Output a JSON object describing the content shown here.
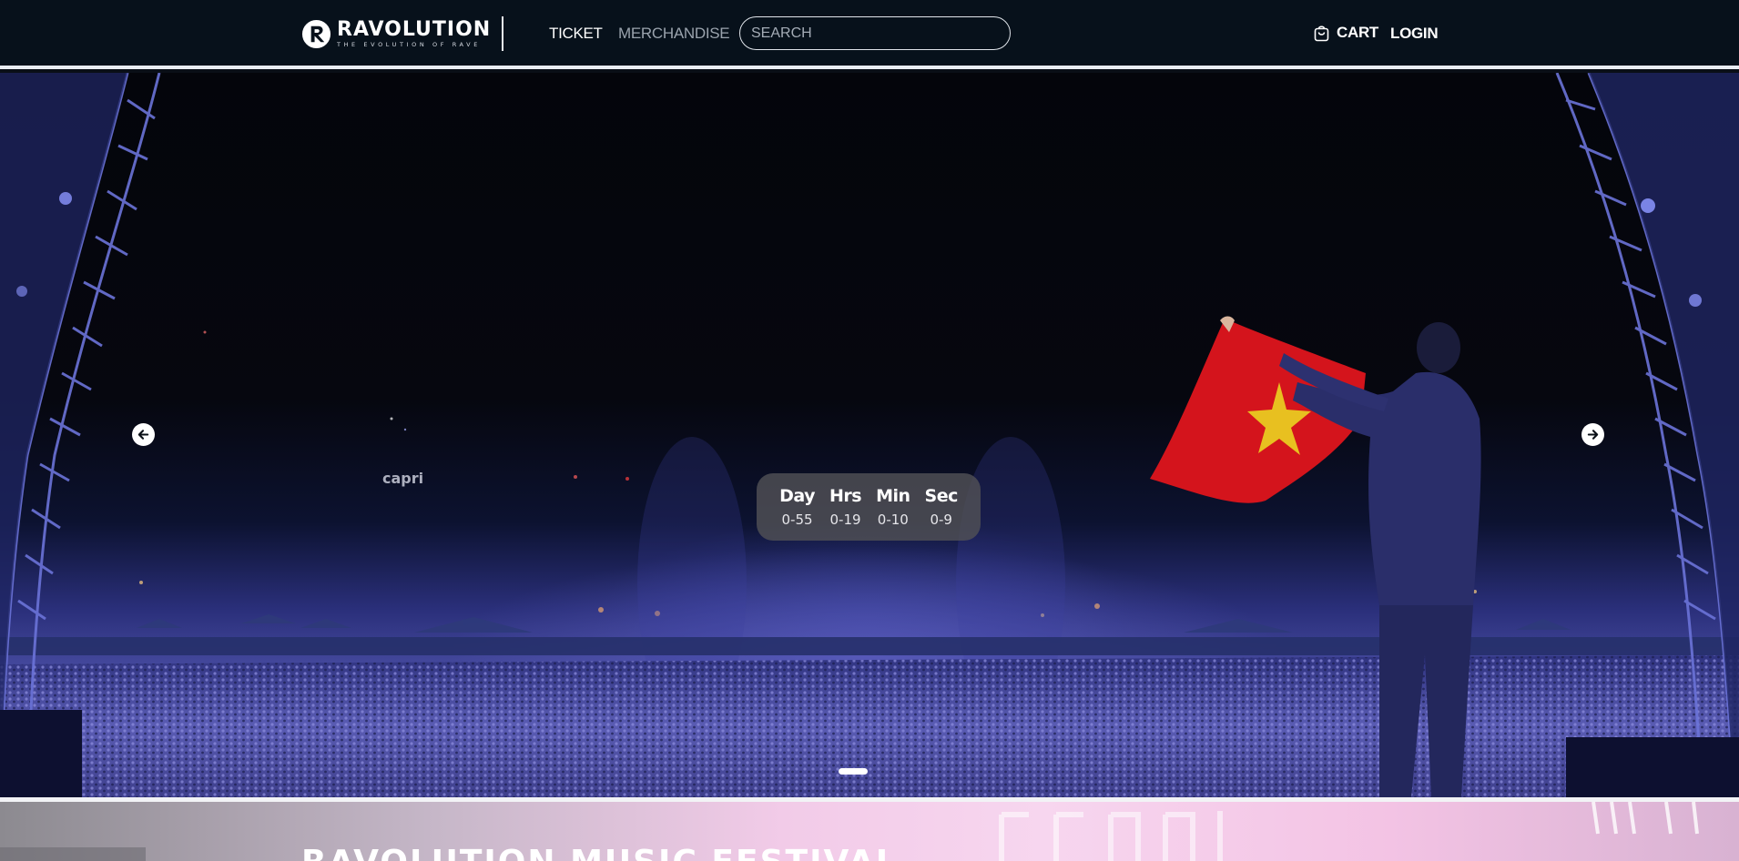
{
  "header": {
    "logo": {
      "name": "RAVOLUTION",
      "tagline": "THE EVOLUTION OF RAVE",
      "icon": "ravolution-logo-icon"
    },
    "nav": [
      {
        "label": "TICKET",
        "active": true
      },
      {
        "label": "MERCHANDISE",
        "active": false
      }
    ],
    "search": {
      "placeholder": "SEARCH",
      "value": ""
    },
    "cart": {
      "label": "CART",
      "icon": "shopping-bag-icon"
    },
    "login": {
      "label": "LOGIN"
    }
  },
  "hero": {
    "background_sign": "capri",
    "prev_icon": "arrow-left-icon",
    "next_icon": "arrow-right-icon",
    "countdown": {
      "units": [
        {
          "label": "Day",
          "value": "0-55"
        },
        {
          "label": "Hrs",
          "value": "0-19"
        },
        {
          "label": "Min",
          "value": "0-10"
        },
        {
          "label": "Sec",
          "value": "0-9"
        }
      ]
    },
    "carousel": {
      "slides": 1,
      "active_index": 0
    }
  },
  "section": {
    "title": "RAVOLUTION MUSIC FESTIVAL"
  },
  "colors": {
    "header_bg": "#07111b",
    "hero_crowd": "#4b4fa6",
    "flag_red": "#d4141c",
    "countdown_bg": "#505056",
    "festival_pink": "#f7d6ef"
  }
}
